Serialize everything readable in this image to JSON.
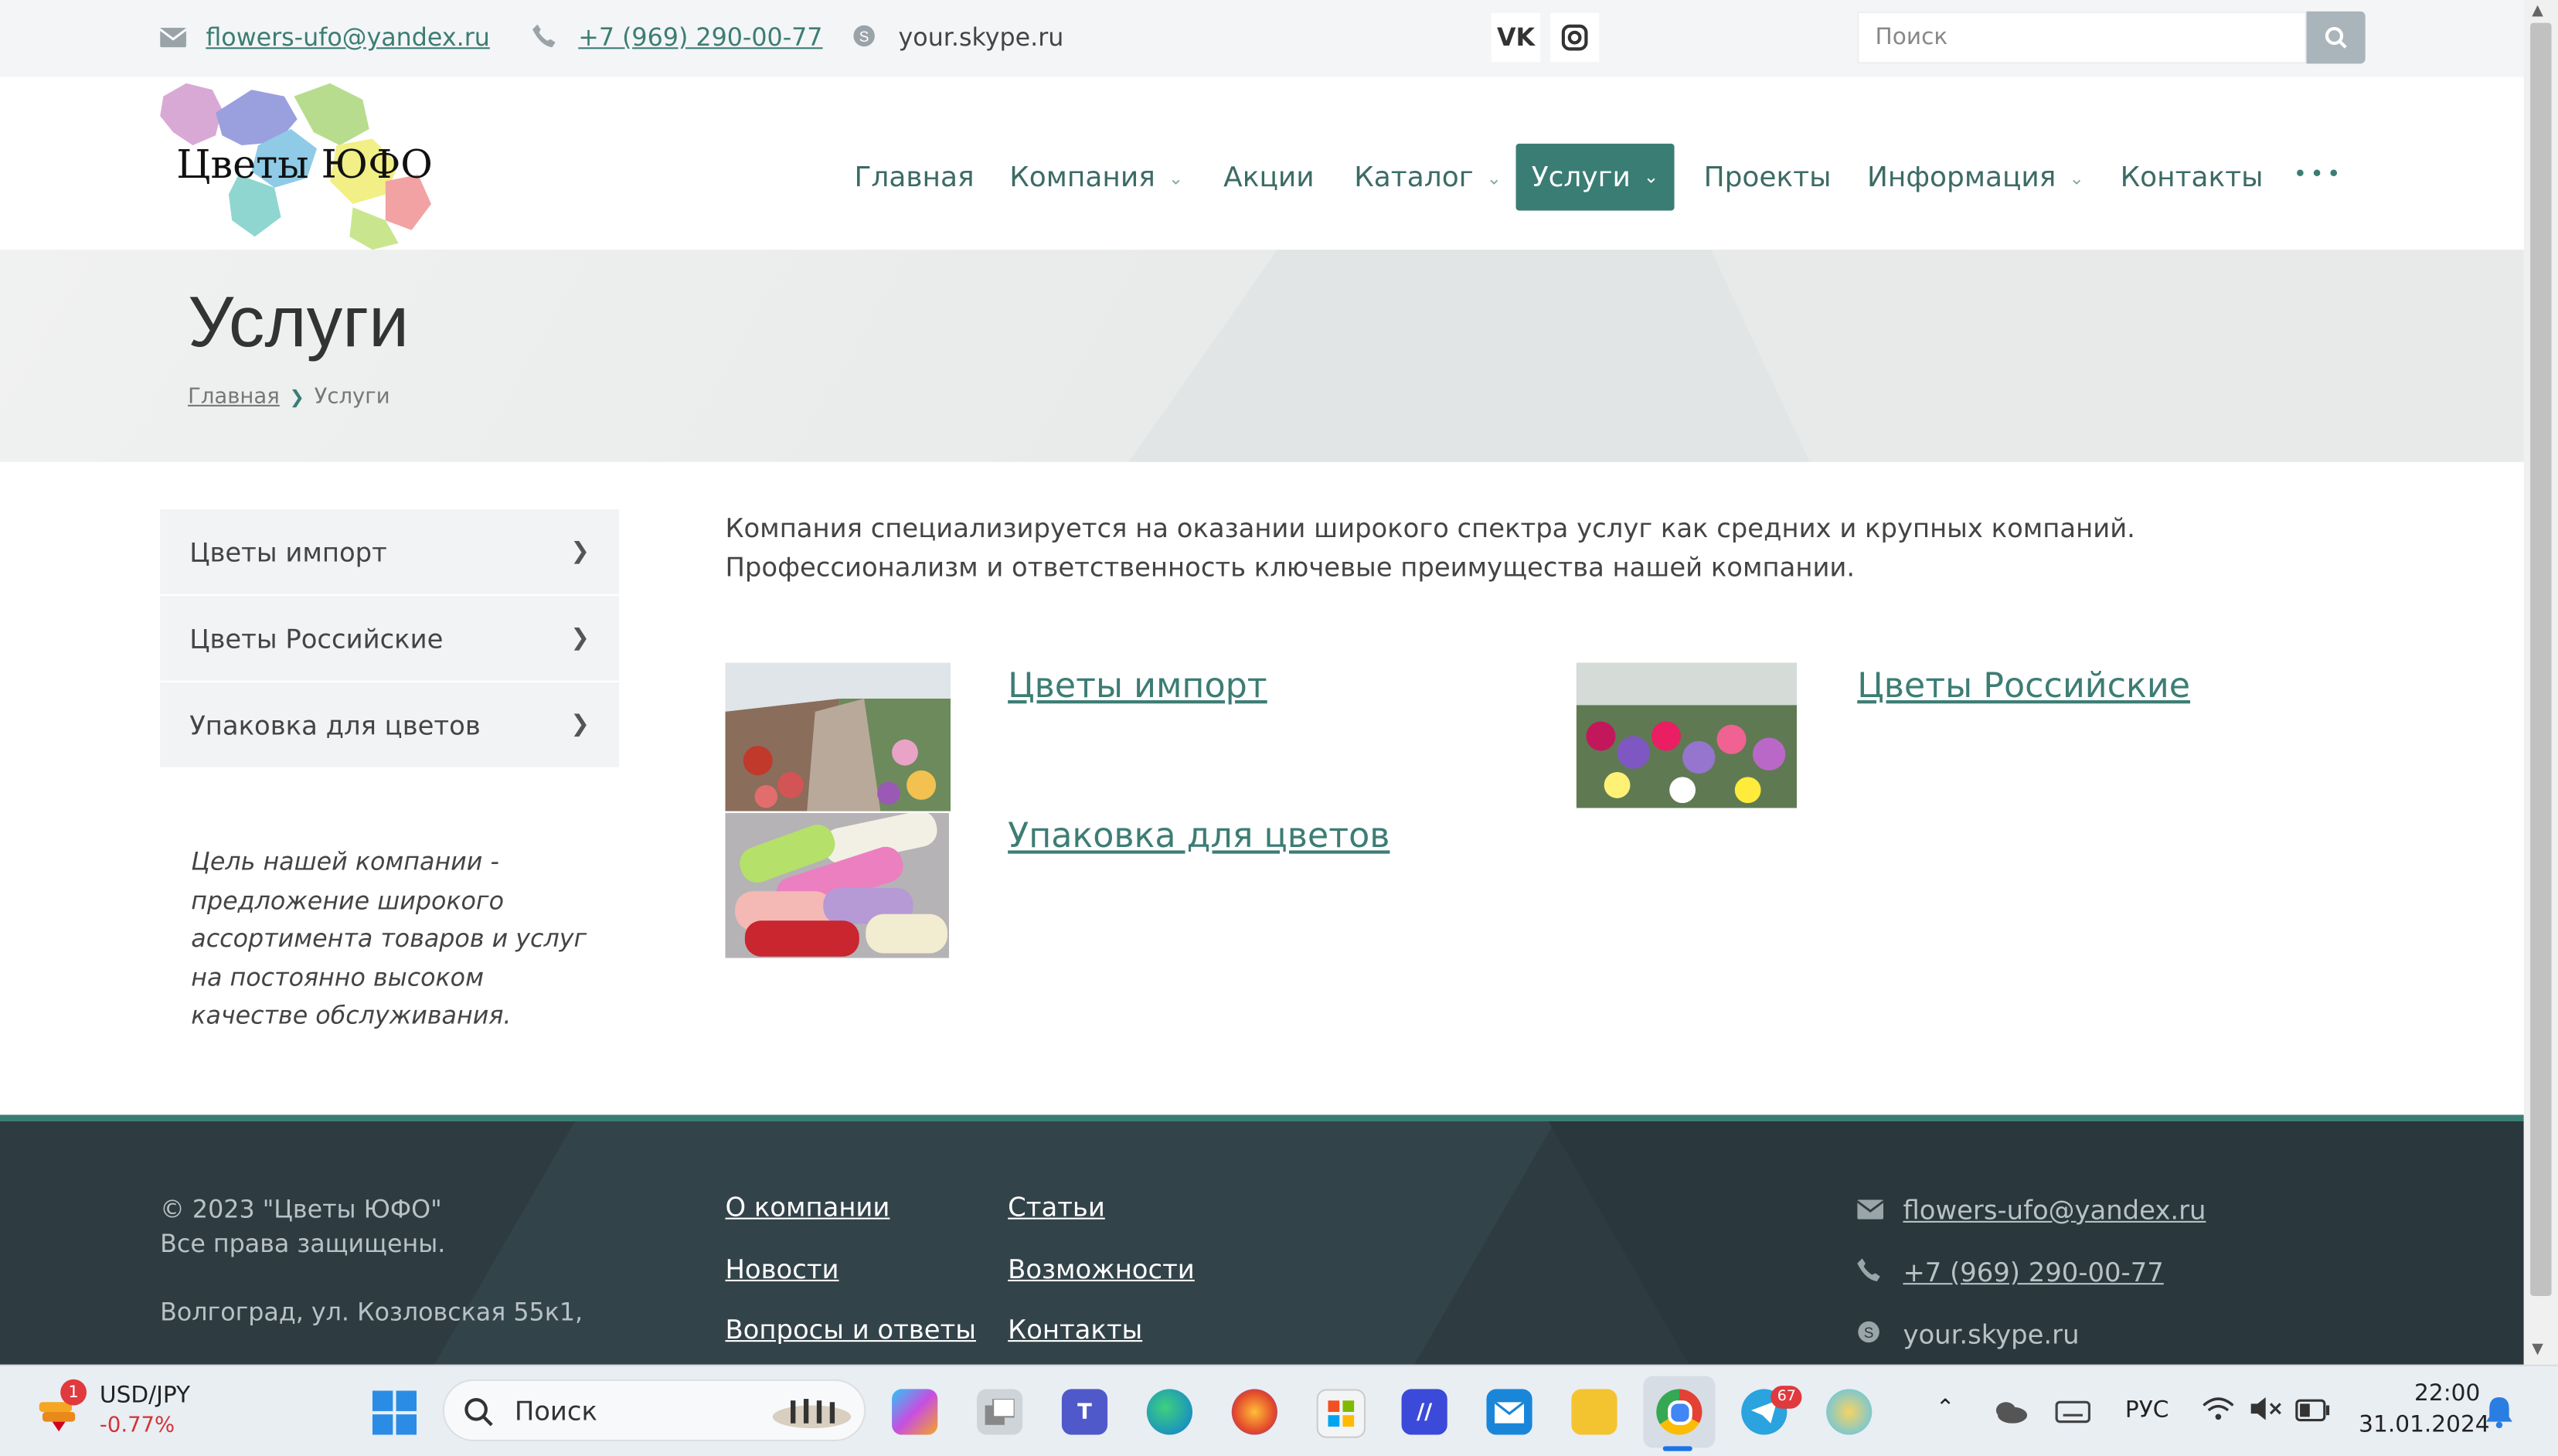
{
  "topbar": {
    "email": "flowers-ufo@yandex.ru",
    "phone": "+7 (969) 290-00-77",
    "skype": "your.skype.ru",
    "social": [
      {
        "icon": "vk-icon",
        "label": "VK"
      },
      {
        "icon": "instagram-icon"
      }
    ],
    "search_placeholder": "Поиск"
  },
  "logo": {
    "text": "Цветы ЮФО"
  },
  "nav": {
    "items": [
      {
        "label": "Главная",
        "has_dropdown": false
      },
      {
        "label": "Компания",
        "has_dropdown": true
      },
      {
        "label": "Акции",
        "has_dropdown": false
      },
      {
        "label": "Каталог",
        "has_dropdown": true
      },
      {
        "label": "Услуги",
        "has_dropdown": true,
        "active": true
      },
      {
        "label": "Проекты",
        "has_dropdown": false
      },
      {
        "label": "Информация",
        "has_dropdown": true
      },
      {
        "label": "Контакты",
        "has_dropdown": false
      }
    ],
    "more": "•••"
  },
  "banner": {
    "title": "Услуги",
    "breadcrumbs": [
      "Главная",
      "Услуги"
    ]
  },
  "sidebar": {
    "items": [
      "Цветы импорт",
      "Цветы Российские",
      "Упаковка для цветов"
    ],
    "quote": "Цель нашей компании - предложение широкого ассортимента товаров и услуг на постоянно высоком качестве обслуживания."
  },
  "content": {
    "intro": "Компания специализируется на оказании широкого спектра услуг как средних и крупных компаний. Профессионализм и ответственность ключевые преимущества нашей компании.",
    "services": [
      "Цветы импорт",
      "Цветы Российские",
      "Упаковка для цветов"
    ]
  },
  "footer": {
    "copyright_line1": "© 2023 \"Цветы ЮФО\"",
    "copyright_line2": "Все права защищены.",
    "address": "Волгоград, ул. Козловская 55к1,",
    "links_col1": [
      "О компании",
      "Новости",
      "Вопросы и ответы"
    ],
    "links_col2": [
      "Статьи",
      "Возможности",
      "Контакты"
    ],
    "email": "flowers-ufo@yandex.ru",
    "phone": "+7 (969) 290-00-77",
    "skype": "your.skype.ru"
  },
  "taskbar": {
    "ticker": "USD/JPY",
    "ticker_change": "-0.77%",
    "ticker_badge": "1",
    "search_label": "Поиск",
    "telegram_badge": "67",
    "language": "РУС",
    "time": "22:00",
    "date": "31.01.2024"
  },
  "colors": {
    "accent": "#3a7d74",
    "footer_bg": "#2e3b40",
    "link": "#3c7d74"
  }
}
